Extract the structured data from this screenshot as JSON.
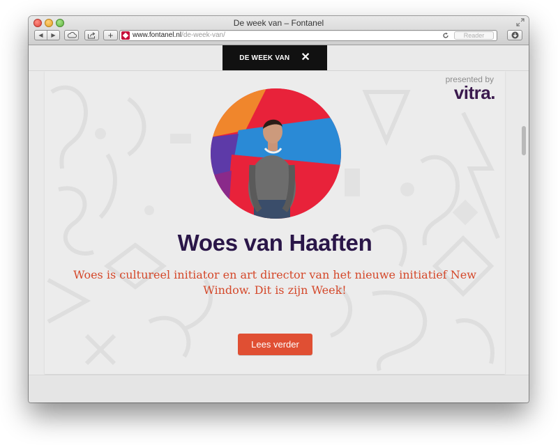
{
  "window": {
    "title": "De week van – Fontanel"
  },
  "toolbar": {
    "back_icon": "chevron-left-icon",
    "forward_icon": "chevron-right-icon",
    "icloud_icon": "cloud-icon",
    "share_icon": "share-icon",
    "new_tab_label": "+",
    "reader_label": "Reader",
    "download_icon": "download-icon"
  },
  "address": {
    "domain": "www.fontanel.nl",
    "path": "/de-week-van/"
  },
  "page": {
    "tab_header": "DE WEEK VAN",
    "close_label": "✕",
    "sponsor_presented": "presented by",
    "sponsor_logo": "vitra.",
    "person_name": "Woes van Haaften",
    "intro": "Woes is cultureel initiator en art director van het nieuwe initiatief New Window. Dit is zijn Week!",
    "button_label": "Lees verder"
  },
  "colors": {
    "name": "#2a1648",
    "intro": "#d4482a",
    "button": "#e04f33",
    "header_bar": "#111111",
    "vitra": "#3b1a4e"
  }
}
